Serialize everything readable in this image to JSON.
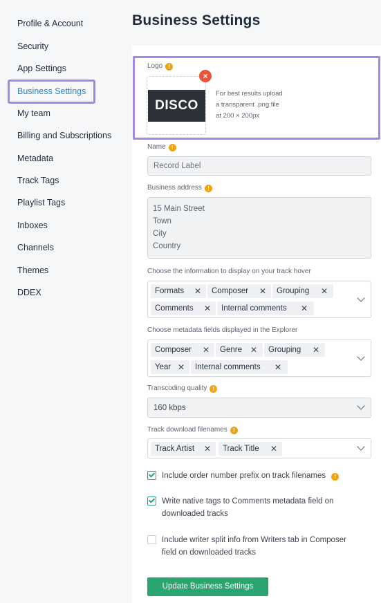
{
  "sidebar": {
    "items": [
      {
        "label": "Profile & Account"
      },
      {
        "label": "Security"
      },
      {
        "label": "App Settings"
      },
      {
        "label": "Business Settings",
        "active": true
      },
      {
        "label": "My team"
      },
      {
        "label": "Billing and Subscriptions"
      },
      {
        "label": "Metadata"
      },
      {
        "label": "Track Tags"
      },
      {
        "label": "Playlist Tags"
      },
      {
        "label": "Inboxes"
      },
      {
        "label": "Channels"
      },
      {
        "label": "Themes"
      },
      {
        "label": "DDEX"
      }
    ]
  },
  "page": {
    "title": "Business Settings"
  },
  "logo": {
    "label": "Logo",
    "image_text": "DISCO",
    "hint": [
      "For best results upload",
      "a transparent .png file",
      "at 200 × 200px"
    ]
  },
  "name": {
    "label": "Name",
    "value": "Record Label"
  },
  "address": {
    "label": "Business address",
    "lines": [
      "15 Main Street",
      "Town",
      "City",
      "Country"
    ]
  },
  "track_hover": {
    "label": "Choose the information to display on your track hover",
    "tags": [
      "Formats",
      "Composer",
      "Grouping",
      "Comments",
      "Internal comments"
    ]
  },
  "explorer_fields": {
    "label": "Choose metadata fields displayed in the Explorer",
    "tags": [
      "Composer",
      "Genre",
      "Grouping",
      "Year",
      "Internal comments"
    ]
  },
  "transcoding": {
    "label": "Transcoding quality",
    "value": "160 kbps"
  },
  "download_filenames": {
    "label": "Track download filenames",
    "tags": [
      "Track Artist",
      "Track Title"
    ]
  },
  "options": [
    {
      "label": "Include order number prefix on track filenames",
      "checked": true
    },
    {
      "lines": [
        "Write native tags to Comments metadata field on",
        "downloaded tracks"
      ],
      "checked": true
    },
    {
      "lines": [
        "Include writer split info from Writers tab in Composer",
        "field on downloaded tracks"
      ],
      "checked": false
    }
  ],
  "submit": {
    "label": "Update Business Settings"
  },
  "icons": {
    "remove": "×",
    "info": "!",
    "tag_remove": "✕"
  },
  "colors": {
    "accent": "#2a86c9",
    "highlight": "#a286e8",
    "primary_button": "#2aa56f",
    "remove": "#e8533a",
    "info": "#f2a20a"
  }
}
